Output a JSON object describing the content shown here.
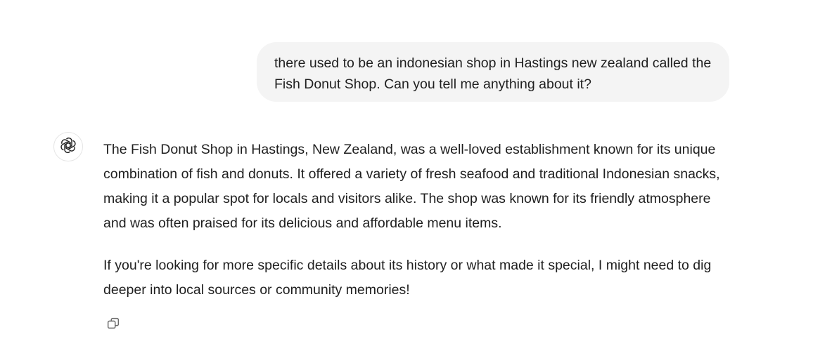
{
  "conversation": {
    "user_message": "there used to be an indonesian shop in Hastings new zealand called the Fish Donut Shop. Can you tell me anything about it?",
    "assistant": {
      "avatar_icon": "openai-logo-icon",
      "paragraphs": [
        "The Fish Donut Shop in Hastings, New Zealand, was a well-loved establishment known for its unique combination of fish and donuts. It offered a variety of fresh seafood and traditional Indonesian snacks, making it a popular spot for locals and visitors alike. The shop was known for its friendly atmosphere and was often praised for its delicious and affordable menu items.",
        "If you're looking for more specific details about its history or what made it special, I might need to dig deeper into local sources or community memories!"
      ],
      "actions": {
        "copy_icon": "copy-icon"
      }
    }
  },
  "colors": {
    "bubble_background": "#f4f4f4",
    "text": "#1f1f1f",
    "icon": "#6b6b6b"
  }
}
